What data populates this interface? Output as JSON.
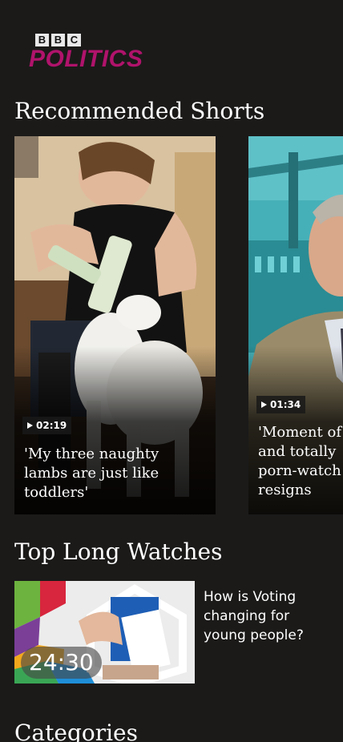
{
  "brand": {
    "letters": [
      "B",
      "B",
      "C"
    ],
    "name": "POLITICS",
    "color": "#b0136b"
  },
  "shorts": {
    "heading": "Recommended Shorts",
    "items": [
      {
        "duration": "02:19",
        "title": "'My three naughty\nlambs are just like\ntoddlers'"
      },
      {
        "duration": "01:34",
        "title": "'Moment of\nand totally\nporn-watch\nresigns"
      }
    ]
  },
  "long_watches": {
    "heading": "Top Long Watches",
    "items": [
      {
        "duration": "24:30",
        "title": "How is Voting changing for young people?"
      }
    ]
  },
  "categories": {
    "heading": "Categories"
  },
  "icons": [
    "play-icon"
  ]
}
